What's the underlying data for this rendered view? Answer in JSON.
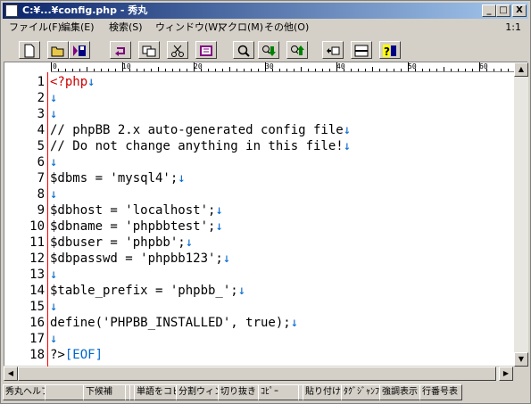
{
  "window": {
    "title": "C:¥...¥config.php  - 秀丸",
    "controls": {
      "minimize": "_",
      "maximize": "□",
      "close": "X"
    }
  },
  "menu": {
    "items": [
      "ファイル(F)",
      "編集(E)",
      "検索(S)",
      "ウィンドウ(W)",
      "マクロ(M)",
      "その他(O)"
    ],
    "position": "1:1"
  },
  "toolbar": {
    "buttons": [
      "new-file-icon",
      "open-folder-icon",
      "save-icon",
      "undo-icon",
      "copy-icon",
      "cut-icon",
      "paste-icon",
      "search-icon",
      "search-down-icon",
      "search-up-icon",
      "bookmark-icon",
      "split-window-icon",
      "help-icon"
    ]
  },
  "ruler": {
    "labels": [
      "0",
      "10",
      "20",
      "30",
      "40",
      "50",
      "60"
    ]
  },
  "editor": {
    "lines": [
      {
        "num": "1",
        "text": "<?php",
        "end": "↓"
      },
      {
        "num": "2",
        "text": "",
        "end": "↓"
      },
      {
        "num": "3",
        "text": "",
        "end": "↓"
      },
      {
        "num": "4",
        "text": "// phpBB 2.x auto-generated config file",
        "end": "↓"
      },
      {
        "num": "5",
        "text": "// Do not change anything in this file!",
        "end": "↓"
      },
      {
        "num": "6",
        "text": "",
        "end": "↓"
      },
      {
        "num": "7",
        "text": "$dbms = 'mysql4';",
        "end": "↓"
      },
      {
        "num": "8",
        "text": "",
        "end": "↓"
      },
      {
        "num": "9",
        "text": "$dbhost = 'localhost';",
        "end": "↓"
      },
      {
        "num": "10",
        "text": "$dbname = 'phpbbtest';",
        "end": "↓"
      },
      {
        "num": "11",
        "text": "$dbuser = 'phpbb';",
        "end": "↓"
      },
      {
        "num": "12",
        "text": "$dbpasswd = 'phpbb123';",
        "end": "↓"
      },
      {
        "num": "13",
        "text": "",
        "end": "↓"
      },
      {
        "num": "14",
        "text": "$table_prefix = 'phpbb_';",
        "end": "↓"
      },
      {
        "num": "15",
        "text": "",
        "end": "↓"
      },
      {
        "num": "16",
        "text": "define('PHPBB_INSTALLED', true);",
        "end": "↓"
      },
      {
        "num": "17",
        "text": "",
        "end": "↓"
      },
      {
        "num": "18",
        "text": "?>",
        "end": "[EOF]"
      }
    ]
  },
  "scroll": {
    "up": "▲",
    "down": "▼",
    "left": "◀",
    "right": "▶"
  },
  "function_keys": [
    "秀丸ヘルプ",
    "",
    "下候補",
    "",
    "",
    "単語をコピ",
    "分割ウィン",
    "切り抜き",
    "ｺﾋﾟｰ",
    "",
    "貼り付け",
    "ﾀｸﾞｼﾞｬﾝﾌﾟ",
    "強調表示",
    "行番号表"
  ]
}
